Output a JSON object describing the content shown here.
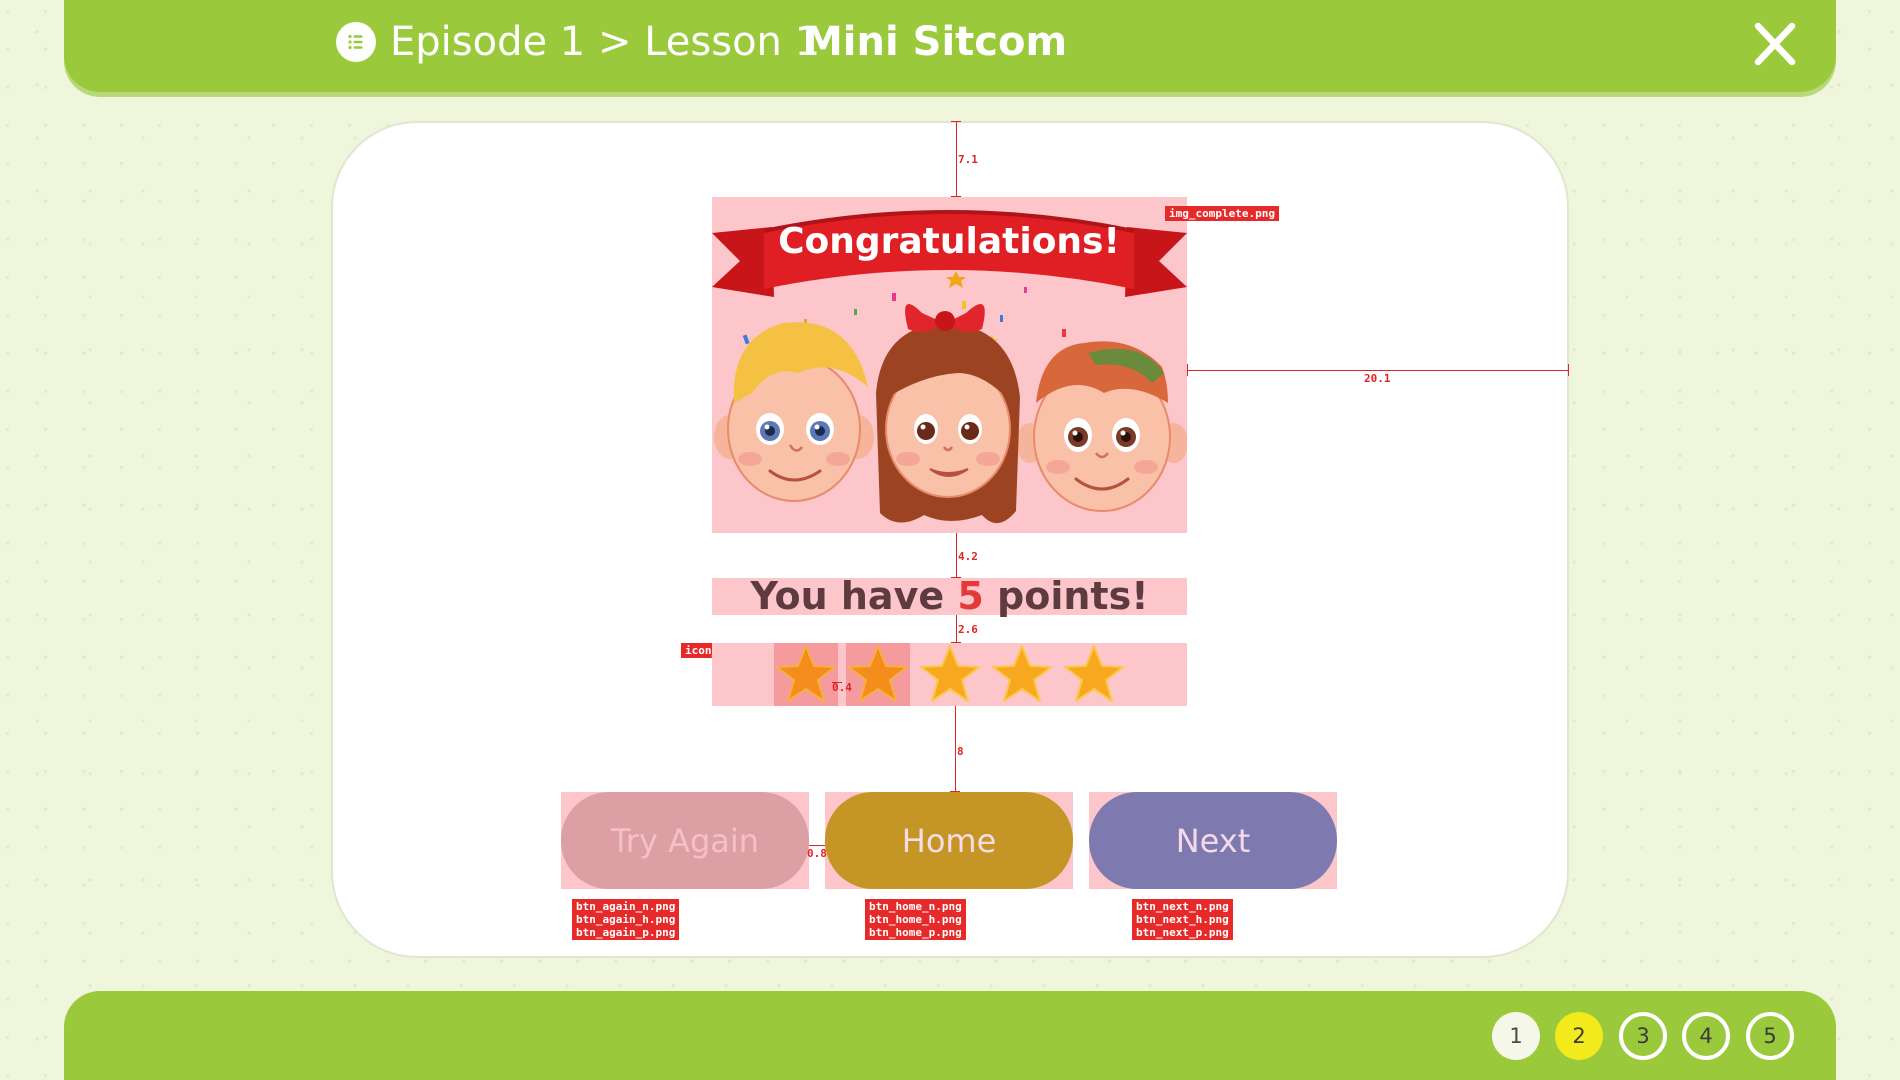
{
  "header": {
    "breadcrumb": "Episode 1 > Lesson 1",
    "title": "Mini Sitcom",
    "close_icon": "close-icon",
    "list_icon": "list-icon"
  },
  "complete_image": {
    "banner_text": "Congratulations!",
    "file_label": "img_complete.png"
  },
  "score": {
    "prefix": "You have",
    "points": "5",
    "suffix": "points!"
  },
  "stars": {
    "count": 5,
    "file_label": "icon_point.png"
  },
  "buttons": {
    "try_again": {
      "label": "Try Again",
      "files": [
        "btn_again_n.png",
        "btn_again_h.png",
        "btn_again_p.png"
      ]
    },
    "home": {
      "label": "Home",
      "files": [
        "btn_home_n.png",
        "btn_home_h.png",
        "btn_home_p.png"
      ]
    },
    "next": {
      "label": "Next",
      "files": [
        "btn_next_n.png",
        "btn_next_h.png",
        "btn_next_p.png"
      ]
    }
  },
  "annotations": {
    "top_gap": "7.1",
    "right_gap": "20.1",
    "img_to_text": "4.2",
    "text_to_stars": "2.6",
    "star_gap": "0.4",
    "stars_to_buttons": "8",
    "button_gap": "0.8"
  },
  "pagination": {
    "pages": [
      "1",
      "2",
      "3",
      "4",
      "5"
    ],
    "current": "2"
  },
  "colors": {
    "header_green": "#9aca3c",
    "background": "#f0f6dc",
    "annotation_red": "#e02424",
    "overlay_pink": "#fcc6ca",
    "active_page": "#f3ea1c"
  }
}
